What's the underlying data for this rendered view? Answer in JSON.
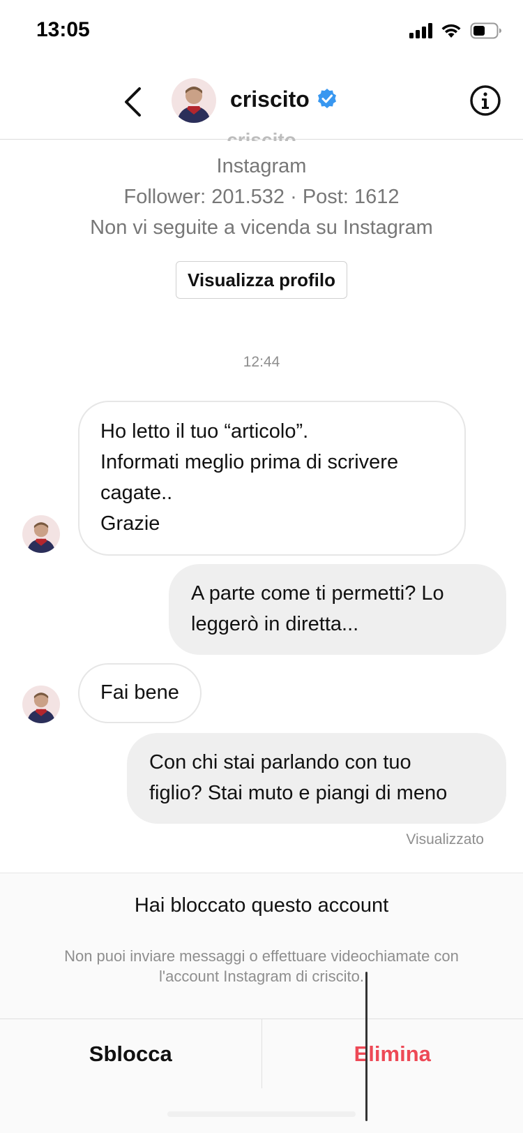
{
  "status_bar": {
    "time": "13:05",
    "icons": [
      "cellular-signal-icon",
      "wifi-icon",
      "battery-icon"
    ]
  },
  "header": {
    "username": "criscito",
    "verified": true,
    "icons": [
      "back-chevron-icon",
      "verified-badge-icon",
      "info-icon"
    ]
  },
  "profile": {
    "ghost_name": "criscito",
    "platform": "Instagram",
    "stats": "Follower: 201.532 · Post: 1612",
    "relationship": "Non vi seguite a vicenda su Instagram",
    "view_profile_label": "Visualizza profilo"
  },
  "chat": {
    "timestamp": "12:44",
    "messages": [
      {
        "direction": "incoming",
        "lines": [
          "Ho letto il tuo “articolo”.",
          "Informati meglio prima di scrivere",
          "cagate..",
          "Grazie"
        ]
      },
      {
        "direction": "outgoing",
        "lines": [
          "A parte come ti permetti? Lo",
          "leggerò in diretta..."
        ]
      },
      {
        "direction": "incoming",
        "lines": [
          "Fai bene"
        ]
      },
      {
        "direction": "outgoing",
        "lines": [
          "Con chi stai parlando con tuo",
          "figlio? Stai muto e piangi di meno"
        ]
      }
    ],
    "seen_label": "Visualizzato"
  },
  "blocked": {
    "title": "Hai bloccato questo account",
    "description_line1": "Non puoi inviare messaggi o effettuare videochiamate con",
    "description_line2": "l'account Instagram di criscito.",
    "unblock_label": "Sblocca",
    "delete_label": "Elimina"
  },
  "colors": {
    "verified_blue": "#3897f0",
    "delete_red": "#ed4956",
    "outgoing_bubble": "#efefef",
    "muted_text": "#8e8e8e"
  }
}
